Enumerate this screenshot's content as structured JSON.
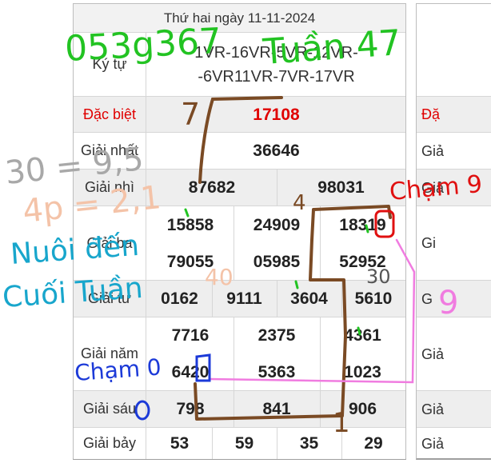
{
  "header": {
    "date": "Thứ hai ngày 11-11-2024"
  },
  "ky_tu": {
    "label": "Ký tự",
    "line1": "1VR-16VR-5VR-12VR-",
    "line2": "-6VR11VR-7VR-17VR"
  },
  "dac_biet": {
    "label": "Đặc biệt",
    "value": "17108"
  },
  "giai_nhat": {
    "label": "Giải nhất",
    "value": "36646"
  },
  "giai_nhi": {
    "label": "Giải nhì",
    "values": [
      "87682",
      "98031"
    ]
  },
  "giai_ba": {
    "label": "Giải ba",
    "values": [
      "15858",
      "24909",
      "18319",
      "79055",
      "05985",
      "52952"
    ]
  },
  "giai_tu": {
    "label": "Giải tư",
    "values": [
      "0162",
      "9111",
      "3604",
      "5610"
    ]
  },
  "giai_nam": {
    "label": "Giải năm",
    "values": [
      "7716",
      "2375",
      "4361",
      "6420",
      "5363",
      "1023"
    ]
  },
  "giai_sau": {
    "label": "Giải sáu",
    "values": [
      "798",
      "841",
      "906"
    ]
  },
  "giai_bay": {
    "label": "Giải bảy",
    "values": [
      "53",
      "59",
      "35",
      "29"
    ]
  },
  "right_table": {
    "labels": [
      "Đặ",
      "Giả",
      "Giả",
      "Gi",
      "G",
      "Giả",
      "Giả",
      "Giả"
    ]
  },
  "annotations": {
    "code": "053g367",
    "week": "Tuần 47",
    "seven": "7",
    "ratio1": "30 = 9,5",
    "ratio2": "4p = 2,1",
    "nuoi": "Nuôi đến",
    "cuoi": "Cuối Tuần",
    "cham9": "Chạm 9",
    "cham0": "Chạm 0",
    "four": "4",
    "forty": "40",
    "thirty": "30",
    "nine": "9",
    "one": "1",
    "colors": {
      "green": "#22c322",
      "brown": "#7a4a24",
      "red": "#e01010",
      "blue": "#1c3ad8",
      "cyan": "#18a6cc",
      "pink": "#f07ce0",
      "peach": "#f4c3a8",
      "gray": "#a8a8a8"
    }
  }
}
